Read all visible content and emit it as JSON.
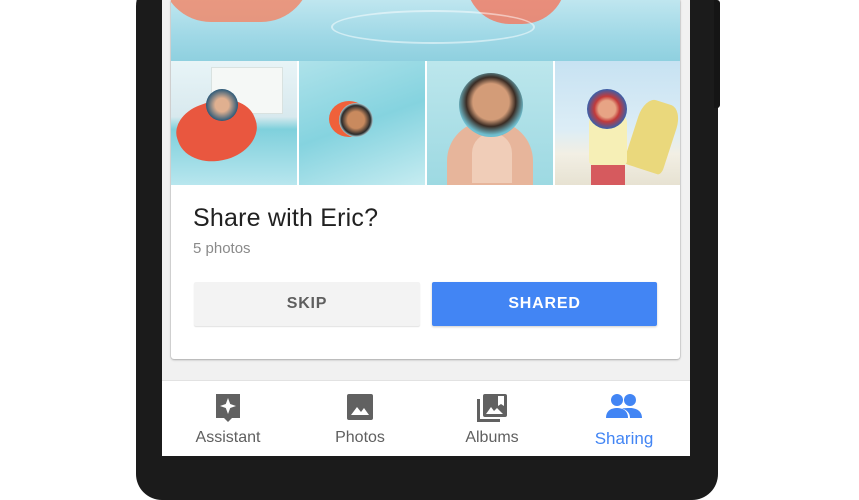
{
  "card": {
    "title": "Share with Eric?",
    "subtitle": "5 photos",
    "skip_label": "SKIP",
    "shared_label": "SHARED"
  },
  "bottom_nav": {
    "items": [
      {
        "label": "Assistant",
        "icon": "assistant-icon",
        "active": false
      },
      {
        "label": "Photos",
        "icon": "photos-icon",
        "active": false
      },
      {
        "label": "Albums",
        "icon": "albums-icon",
        "active": false
      },
      {
        "label": "Sharing",
        "icon": "sharing-icon",
        "active": true
      }
    ]
  },
  "colors": {
    "accent": "#4285f4",
    "inactive_icon": "#616161",
    "title_text": "#212121",
    "subtitle_text": "#8a8a8a"
  }
}
